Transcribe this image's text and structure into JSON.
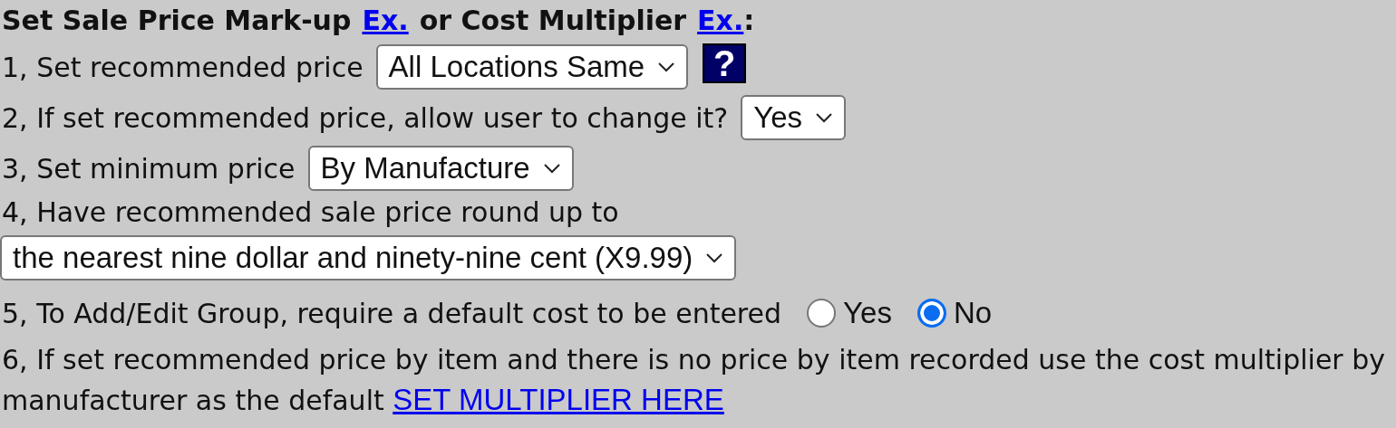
{
  "heading": [
    {
      "kind": "text",
      "text": "Set Sale Price Mark-up"
    },
    {
      "kind": "link",
      "text": "Ex."
    },
    {
      "kind": "text",
      "text": "or Cost Multiplier"
    },
    {
      "kind": "link",
      "text": "Ex."
    },
    {
      "kind": "punct",
      "text": ":"
    }
  ],
  "settings": [
    {
      "kind": "select",
      "label": "1, Set recommended price",
      "value": "All Locations Same",
      "help": "?"
    },
    {
      "kind": "select",
      "label": "2, If set recommended price, allow user to change it?",
      "value": "Yes"
    },
    {
      "kind": "select",
      "label": "3, Set minimum price",
      "value": "By Manufacture"
    },
    {
      "kind": "select_below",
      "label": "4, Have recommended sale price round up to",
      "value": "the nearest nine dollar and ninety-nine cent (X9.99)"
    },
    {
      "kind": "radio",
      "label": "5, To Add/Edit Group, require a default cost to be entered",
      "options": [
        {
          "label": "Yes",
          "selected": false
        },
        {
          "label": "No",
          "selected": true
        }
      ]
    },
    {
      "kind": "text_link",
      "label": "6, If set recommended price by item and there is no price by item recorded use the cost multiplier by manufacturer as the default",
      "link": "SET MULTIPLIER HERE"
    }
  ]
}
